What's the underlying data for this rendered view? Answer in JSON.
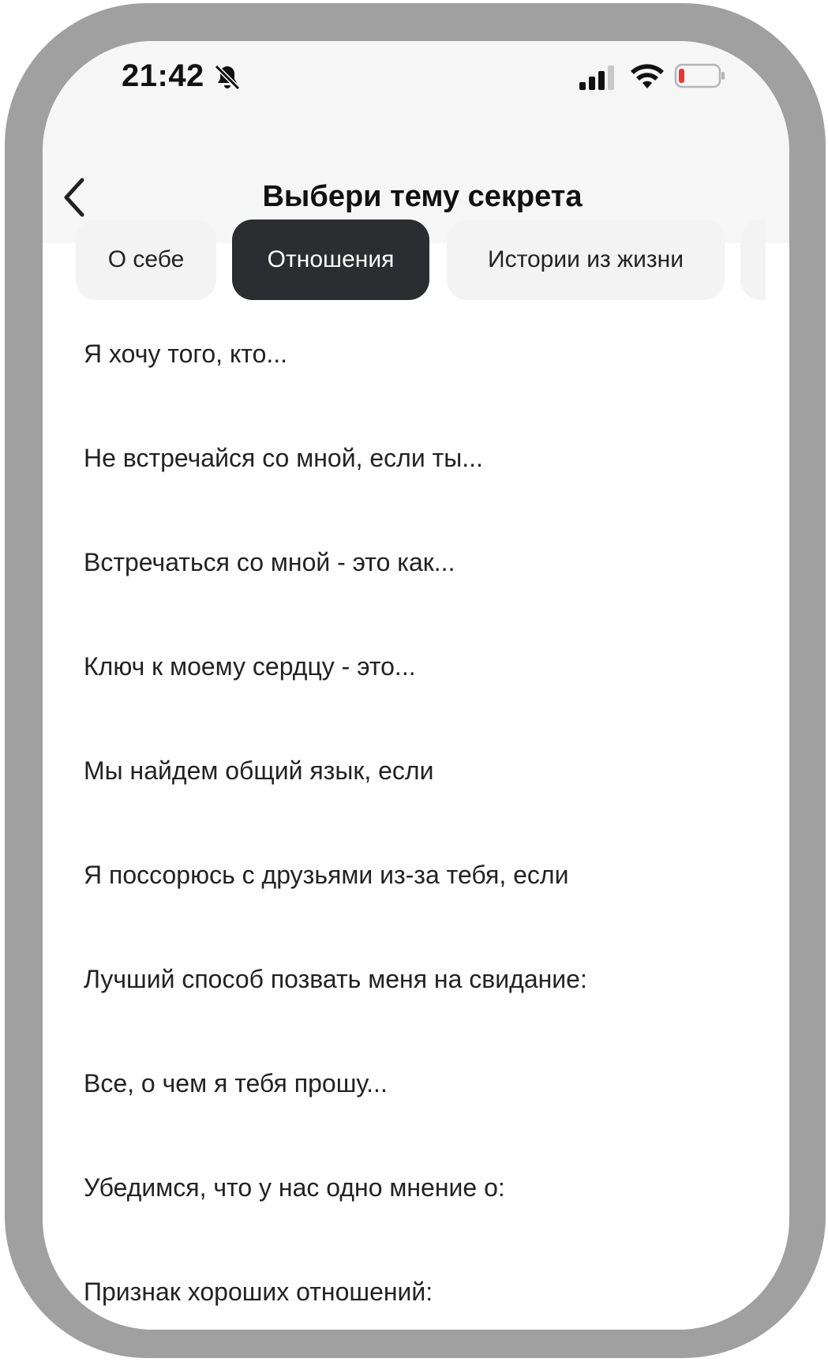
{
  "status_bar": {
    "time": "21:42",
    "icons": [
      "bell-slash-icon",
      "cellular-signal-icon",
      "wifi-icon",
      "battery-low-icon"
    ],
    "battery_color": "#e53935"
  },
  "nav": {
    "back_icon": "chevron-left-icon",
    "title": "Выбери тему секрета"
  },
  "tabs": [
    {
      "label": "О себе",
      "active": false
    },
    {
      "label": "Отношения",
      "active": true
    },
    {
      "label": "Истории из жизни",
      "active": false
    },
    {
      "label": "",
      "active": false
    }
  ],
  "topics": [
    "Я хочу того, кто...",
    "Не встречайся со мной, если ты...",
    "Встречаться со мной - это как...",
    "Ключ к моему сердцу - это...",
    "Мы найдем общий язык, если",
    "Я поссорюсь с друзьями из-за тебя, если",
    "Лучший способ позвать меня на свидание:",
    "Все, о чем я тебя прошу...",
    "Убедимся, что у нас одно мнение о:",
    "Признак хороших отношений:"
  ],
  "colors": {
    "active_tab": "#2c2d30",
    "inactive_tab": "#f3f3f3",
    "frame": "#a0a0a0"
  }
}
